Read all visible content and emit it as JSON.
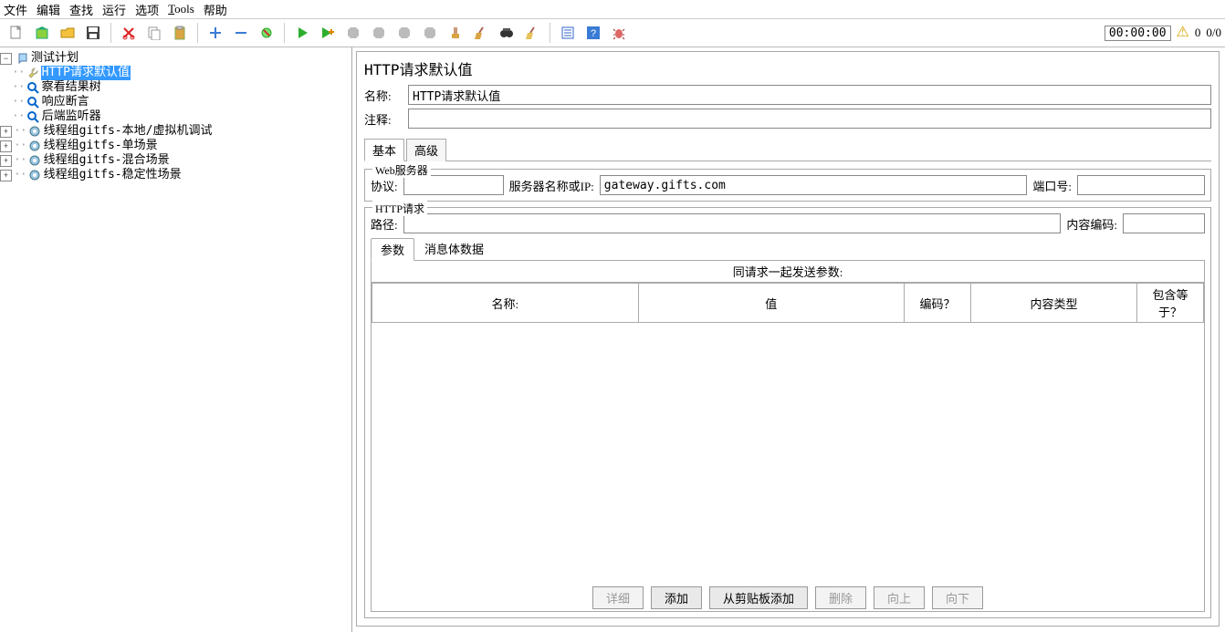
{
  "menu": [
    "文件",
    "编辑",
    "查找",
    "运行",
    "选项",
    "Tools",
    "帮助"
  ],
  "toolbar_right": {
    "timer": "00:00:00",
    "warn_count": "0",
    "page": "0/0"
  },
  "tree": {
    "root": "测试计划",
    "children": [
      {
        "icon": "wrench",
        "label": "HTTP请求默认值",
        "selected": true
      },
      {
        "icon": "magnifier",
        "label": "察看结果树"
      },
      {
        "icon": "magnifier",
        "label": "响应断言"
      },
      {
        "icon": "magnifier",
        "label": "后端监听器"
      },
      {
        "icon": "gear",
        "label": "线程组gitfs-本地/虚拟机调试",
        "expandable": true
      },
      {
        "icon": "gear",
        "label": "线程组gitfs-单场景",
        "expandable": true
      },
      {
        "icon": "gear",
        "label": "线程组gitfs-混合场景",
        "expandable": true
      },
      {
        "icon": "gear",
        "label": "线程组gitfs-稳定性场景",
        "expandable": true
      }
    ]
  },
  "panel": {
    "title": "HTTP请求默认值",
    "name_label": "名称:",
    "name_value": "HTTP请求默认值",
    "comment_label": "注释:",
    "comment_value": "",
    "tabs": [
      "基本",
      "高级"
    ],
    "active_tab": 0,
    "webserver": {
      "legend": "Web服务器",
      "protocol_label": "协议:",
      "protocol_value": "",
      "server_label": "服务器名称或IP:",
      "server_value": "gateway.gifts.com",
      "port_label": "端口号:",
      "port_value": ""
    },
    "http": {
      "legend": "HTTP请求",
      "path_label": "路径:",
      "path_value": "",
      "encoding_label": "内容编码:",
      "encoding_value": "",
      "param_tabs": [
        "参数",
        "消息体数据"
      ],
      "active_param_tab": 0,
      "params_header": "同请求一起发送参数:",
      "columns": [
        "名称:",
        "值",
        "编码？",
        "内容类型",
        "包含等于？"
      ],
      "buttons": {
        "detail": "详细",
        "add": "添加",
        "clipboard": "从剪贴板添加",
        "delete": "删除",
        "up": "向上",
        "down": "向下"
      }
    }
  }
}
